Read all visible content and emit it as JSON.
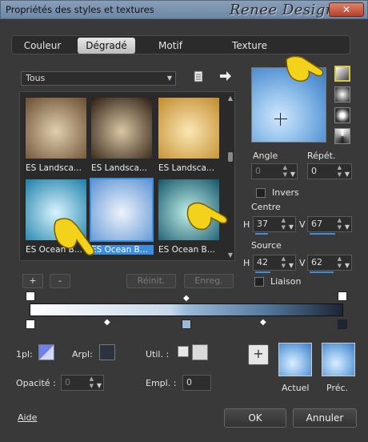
{
  "window": {
    "title": "Propriétés des styles et textures",
    "brand_watermark": "Renee Design",
    "close_label": "✕"
  },
  "tabs": [
    {
      "label": "Couleur",
      "active": false
    },
    {
      "label": "Dégradé",
      "active": true
    },
    {
      "label": "Motif",
      "active": false
    },
    {
      "label": "Texture",
      "active": false
    }
  ],
  "category": {
    "value": "Tous"
  },
  "thumbnails": [
    {
      "label": "ES Landsca...",
      "colors": [
        "#e0cfb0",
        "#6a4c30"
      ],
      "selected": false
    },
    {
      "label": "ES Landsca...",
      "colors": [
        "#d9c6a4",
        "#2a1c10"
      ],
      "selected": false
    },
    {
      "label": "ES Landsca...",
      "colors": [
        "#fbe7b4",
        "#c28a2c"
      ],
      "selected": false
    },
    {
      "label": "ES Ocean B...",
      "colors": [
        "#d8f4ff",
        "#1b7fa8"
      ],
      "selected": false
    },
    {
      "label": "ES Ocean B...",
      "colors": [
        "#eef4fb",
        "#5c93d4"
      ],
      "selected": true
    },
    {
      "label": "ES Ocean B...",
      "colors": [
        "#bff0e8",
        "#15556a"
      ],
      "selected": false
    }
  ],
  "grid_buttons": {
    "add": "+",
    "remove": "-",
    "reset": "Réinit.",
    "save": "Enreg."
  },
  "angle": {
    "label": "Angle",
    "value": "0"
  },
  "repeat": {
    "label": "Répét.",
    "value": "0"
  },
  "invert": {
    "label": "Invers",
    "checked": false
  },
  "center": {
    "label": "Centre",
    "h_label": "H",
    "h_value": "37",
    "v_label": "V",
    "v_value": "67"
  },
  "source": {
    "label": "Source",
    "h_label": "H",
    "h_value": "42",
    "v_label": "V",
    "v_value": "62"
  },
  "link": {
    "label": "Liaison",
    "checked": false
  },
  "editor": {
    "opl_label": "1pl:",
    "arpl_label": "Arpl:",
    "util_label": "Util. :",
    "opacity_label": "Opacité :",
    "opacity_value": "0",
    "empl_label": "Empl. :",
    "empl_value": "0"
  },
  "previews": {
    "current_label": "Actuel",
    "previous_label": "Préc.",
    "add_label": "+"
  },
  "footer": {
    "help": "Aide",
    "ok": "OK",
    "cancel": "Annuler"
  },
  "icons": {
    "pointer": "pointing-hand-icon",
    "import": "import-icon",
    "arrow": "arrow-right-icon"
  }
}
